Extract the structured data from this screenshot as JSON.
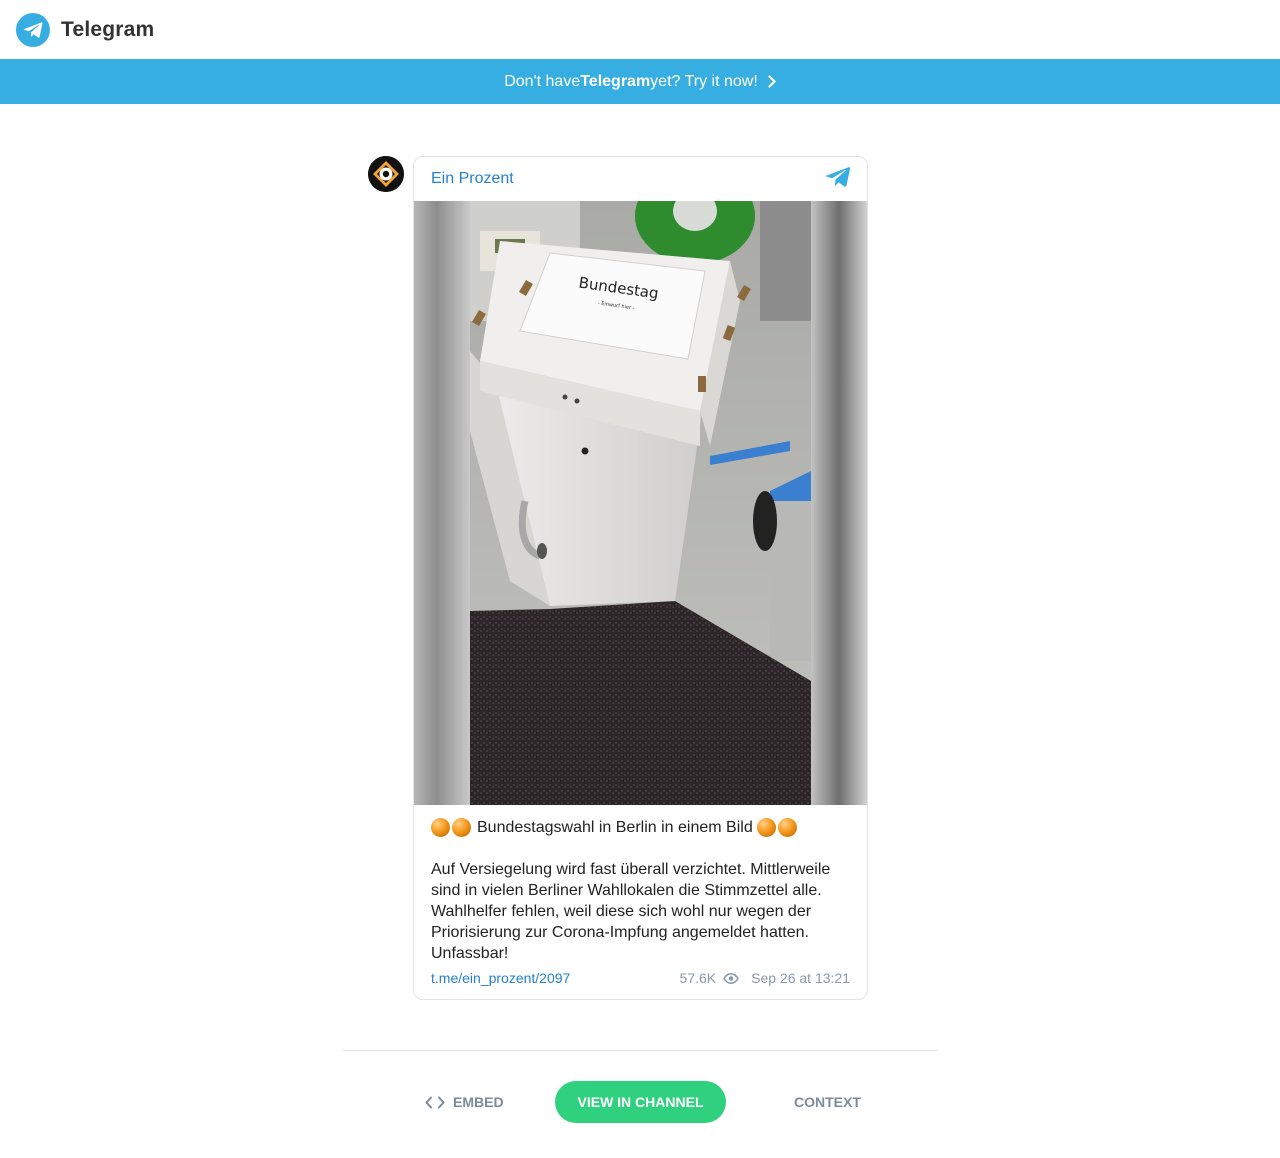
{
  "app": {
    "brand": "Telegram",
    "brand_color": "#37aee2"
  },
  "banner": {
    "prefix": "Don't have ",
    "brand": "Telegram",
    "suffix": " yet? Try it now!"
  },
  "post": {
    "channel_name": "Ein Prozent",
    "photo_label": "Bundestag",
    "photo_sublabel": "- Einwurf hier -",
    "title": "Bundestagswahl in Berlin in einem Bild",
    "body": "Auf Versiegelung wird fast überall verzichtet. Mittlerweile sind in vielen Berliner Wahllokalen die Stimmzettel alle. Wahlhelfer fehlen, weil diese sich wohl nur wegen der Priorisierung zur Corona-Impfung angemeldet hatten. Unfassbar!",
    "link": "t.me/ein_prozent/2097",
    "views": "57.6K",
    "date": "Sep 26 at 13:21"
  },
  "actions": {
    "embed": "EMBED",
    "view_in_channel": "VIEW IN CHANNEL",
    "context": "CONTEXT",
    "view_color": "#2fd07e"
  }
}
